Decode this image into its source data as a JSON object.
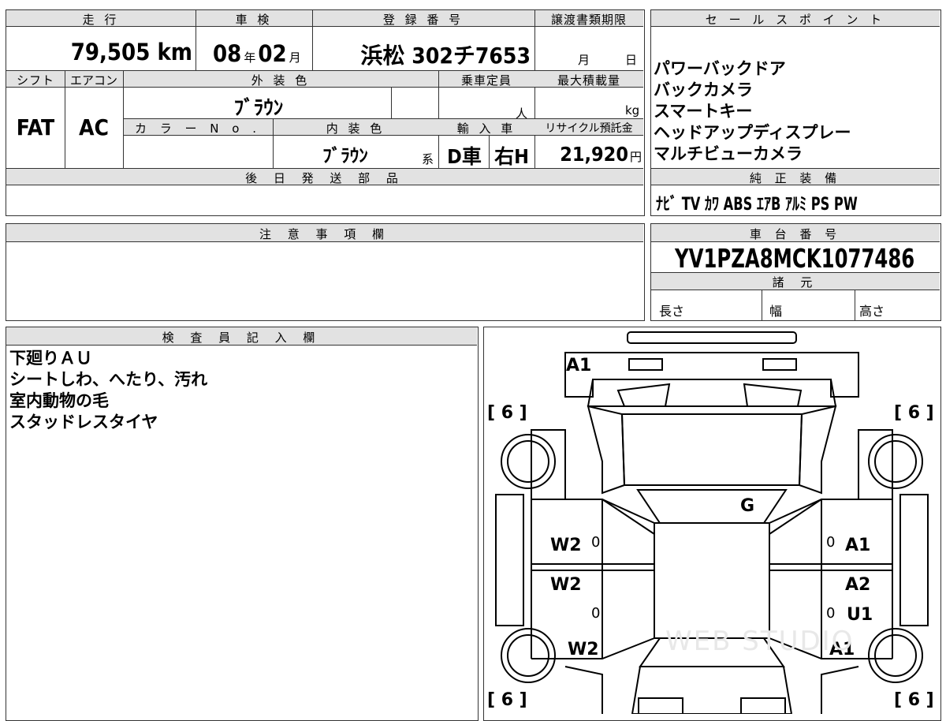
{
  "labels": {
    "mileage": "走 行",
    "inspection": "車 検",
    "registration": "登 録 番 号",
    "transfer_deadline": "譲渡書類期限",
    "sales_points": "セ ー ル ス ポ イ ン ト",
    "shift": "シフト",
    "aircon": "エアコン",
    "exterior_color": "外 装 色",
    "capacity": "乗車定員",
    "max_load": "最大積載量",
    "color_no": "カ ラ ー N o .",
    "interior_color": "内 装 色",
    "import": "輸 入 車",
    "recycle": "リサイクル預託金",
    "later_parts": "後 日 発 送 部 品",
    "genuine_equipment": "純 正 装 備",
    "notes": "注 意 事 項 欄",
    "chassis_number": "車 台 番 号",
    "specs": "諸 元",
    "length": "長さ",
    "width": "幅",
    "height": "高さ",
    "inspector_notes": "検 査 員 記 入 欄"
  },
  "values": {
    "mileage": "79,505",
    "mileage_unit": "km",
    "inspection_year": "08",
    "year_unit": "年",
    "inspection_month": "02",
    "month_unit": "月",
    "registration": "浜松 302チ7653",
    "deadline_month": "月",
    "deadline_day": "日",
    "shift": "FAT",
    "aircon": "AC",
    "exterior_color": "ﾌﾞﾗｳﾝ",
    "capacity_unit": "人",
    "max_load_unit": "kg",
    "interior_color": "ﾌﾞﾗｳﾝ",
    "interior_suffix": "系",
    "import_type": "D車",
    "steering": "右H",
    "recycle_fee": "21,920",
    "recycle_unit": "円",
    "chassis_number": "YV1PZA8MCK1077486",
    "genuine_equipment": "ﾅﾋﾞ TV ｶﾜ ABS ｴｱB ｱﾙﾐ PS PW"
  },
  "sales_points": [
    "パワーバックドア",
    "バックカメラ",
    "スマートキー",
    "ヘッドアップディスプレー",
    "マルチビューカメラ"
  ],
  "inspector_notes": [
    "下廻りＡＵ",
    "シートしわ、へたり、汚れ",
    "室内動物の毛",
    "スタッドレスタイヤ"
  ],
  "diagram": {
    "front": "A1",
    "tire_fl": "[ 6 ]",
    "tire_fr": "[ 6 ]",
    "tire_rl": "[ 6 ]",
    "tire_rr": "[ 6 ]",
    "windshield": "G",
    "left_front_door": "W2",
    "left_front_door_mark": "0",
    "left_rear_door": "W2",
    "left_rear_door_mark": "0",
    "left_rear_fender": "W2",
    "right_front_door": "A1",
    "right_front_door_mark": "0",
    "right_rear_door_1": "A2",
    "right_rear_door_2": "U1",
    "right_rear_door_mark": "0",
    "right_rear_fender": "A1",
    "watermark": "WEB STUDIO"
  }
}
